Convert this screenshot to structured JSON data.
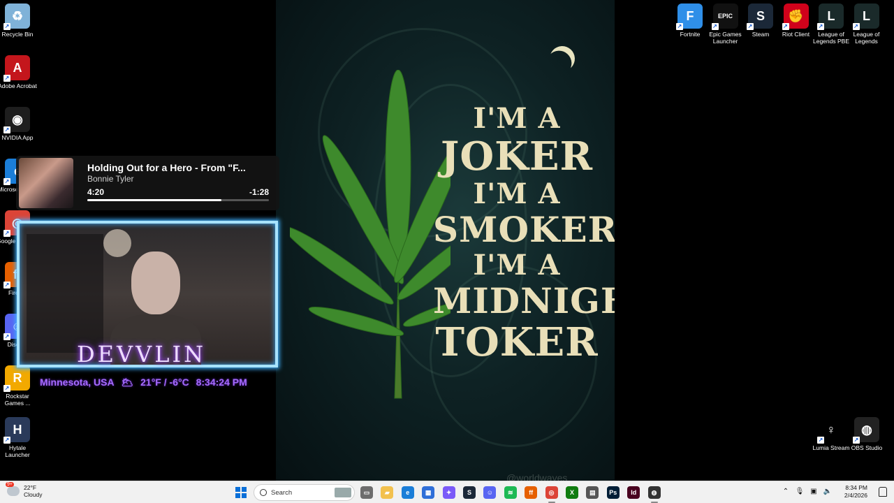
{
  "wallpaper": {
    "lines": [
      "I'M A",
      "JOKER",
      "I'M A",
      "SMOKER",
      "I'M A",
      "MIDNIGHT",
      "TOKER"
    ],
    "credit": "@worldwaves"
  },
  "desktop_left": [
    {
      "label": "Recycle Bin",
      "icon": "recycle-bin-icon",
      "color": "#7fb2d8",
      "glyph": "♻"
    },
    {
      "label": "Adobe Acrobat",
      "icon": "adobe-acrobat-icon",
      "color": "#c4161c",
      "glyph": "A"
    },
    {
      "label": "NVIDIA App",
      "icon": "nvidia-icon",
      "color": "#1e1e1e",
      "glyph": "◉"
    },
    {
      "label": "Microsoft Edge",
      "icon": "edge-icon",
      "color": "#1b7ed8",
      "glyph": "e"
    },
    {
      "label": "Google Chrome",
      "icon": "chrome-icon",
      "color": "#dc4437",
      "glyph": "◎"
    },
    {
      "label": "Firefox",
      "icon": "firefox-icon",
      "color": "#e66000",
      "glyph": "ff"
    },
    {
      "label": "Discord",
      "icon": "discord-icon",
      "color": "#5865f2",
      "glyph": "☺"
    },
    {
      "label": "Rockstar Games ...",
      "icon": "rockstar-icon",
      "color": "#f2a900",
      "glyph": "R"
    },
    {
      "label": "Hytale Launcher",
      "icon": "hytale-icon",
      "color": "#2a3a5a",
      "glyph": "H"
    }
  ],
  "desktop_right_top": [
    {
      "label": "Fortnite",
      "icon": "fortnite-icon",
      "color": "#2f8fe8",
      "glyph": "F"
    },
    {
      "label": "Epic Games Launcher",
      "icon": "epic-games-icon",
      "color": "#111",
      "glyph": "EPIC"
    },
    {
      "label": "Steam",
      "icon": "steam-icon",
      "color": "#1b2838",
      "glyph": "S"
    },
    {
      "label": "Riot Client",
      "icon": "riot-client-icon",
      "color": "#d0021b",
      "glyph": "✊"
    },
    {
      "label": "League of Legends PBE",
      "icon": "league-pbe-icon",
      "color": "#1a2a2a",
      "glyph": "L"
    },
    {
      "label": "League of Legends",
      "icon": "league-icon",
      "color": "#1a2a2a",
      "glyph": "L"
    }
  ],
  "desktop_right_bottom": [
    {
      "label": "Lumia Stream",
      "icon": "lumia-stream-icon",
      "color": "#000",
      "glyph": "♀"
    },
    {
      "label": "OBS Studio",
      "icon": "obs-icon",
      "color": "#222",
      "glyph": "◍"
    }
  ],
  "media": {
    "title": "Holding Out for a Hero - From \"F...",
    "artist": "Bonnie Tyler",
    "elapsed": "4:20",
    "remaining": "-1:28",
    "progress": 0.74
  },
  "webcam": {
    "name": "DEVVLIN",
    "location": "Minnesota, USA",
    "weather_glyph": "🌥",
    "temperature": "21°F / -6°C",
    "time": "8:34:24 PM"
  },
  "taskbar": {
    "weather_temp": "22°F",
    "weather_desc": "Cloudy",
    "weather_badge": "9+",
    "search_placeholder": "Search",
    "apps": [
      {
        "name": "task-view",
        "color": "#6d6d6d",
        "glyph": "▭"
      },
      {
        "name": "file-explorer",
        "color": "#f2c14e",
        "glyph": "▰"
      },
      {
        "name": "edge",
        "color": "#1b7ed8",
        "glyph": "e"
      },
      {
        "name": "microsoft-store",
        "color": "#2f6fd8",
        "glyph": "▦"
      },
      {
        "name": "copilot",
        "color": "#7a5af8",
        "glyph": "✦"
      },
      {
        "name": "steam",
        "color": "#1b2838",
        "glyph": "S"
      },
      {
        "name": "discord",
        "color": "#5865f2",
        "glyph": "☺"
      },
      {
        "name": "spotify",
        "color": "#1db954",
        "glyph": "≋"
      },
      {
        "name": "firefox",
        "color": "#e66000",
        "glyph": "ff"
      },
      {
        "name": "chrome",
        "color": "#dc4437",
        "glyph": "◎"
      },
      {
        "name": "xbox",
        "color": "#107c10",
        "glyph": "X"
      },
      {
        "name": "app-window",
        "color": "#555",
        "glyph": "▤"
      },
      {
        "name": "photoshop",
        "color": "#001e36",
        "glyph": "Ps"
      },
      {
        "name": "indesign",
        "color": "#49021f",
        "glyph": "Id"
      },
      {
        "name": "obs",
        "color": "#333",
        "glyph": "◍"
      }
    ],
    "time": "8:34 PM",
    "date": "2/4/2026"
  }
}
